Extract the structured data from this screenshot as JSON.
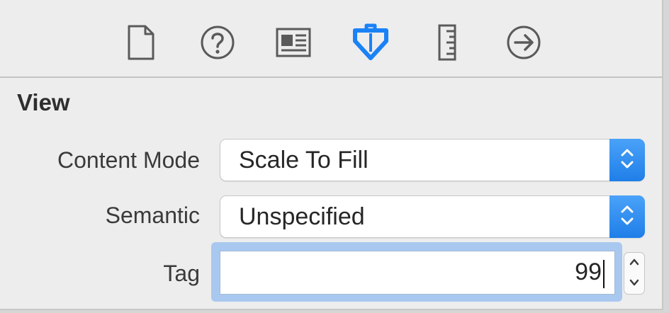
{
  "toolbar": {
    "tabs": [
      {
        "name": "file-inspector",
        "icon": "document-icon"
      },
      {
        "name": "quick-help",
        "icon": "question-icon"
      },
      {
        "name": "identity-inspector",
        "icon": "identity-card-icon"
      },
      {
        "name": "attributes-inspector",
        "icon": "attributes-icon",
        "active": true
      },
      {
        "name": "size-inspector",
        "icon": "ruler-icon"
      },
      {
        "name": "connections-inspector",
        "icon": "arrow-circle-icon"
      }
    ],
    "active_color": "#1a82f7",
    "icon_color": "#5a5a5a"
  },
  "section": {
    "title": "View"
  },
  "content_mode": {
    "label": "Content Mode",
    "value": "Scale To Fill"
  },
  "semantic": {
    "label": "Semantic",
    "value": "Unspecified"
  },
  "tag": {
    "label": "Tag",
    "value": "99"
  }
}
